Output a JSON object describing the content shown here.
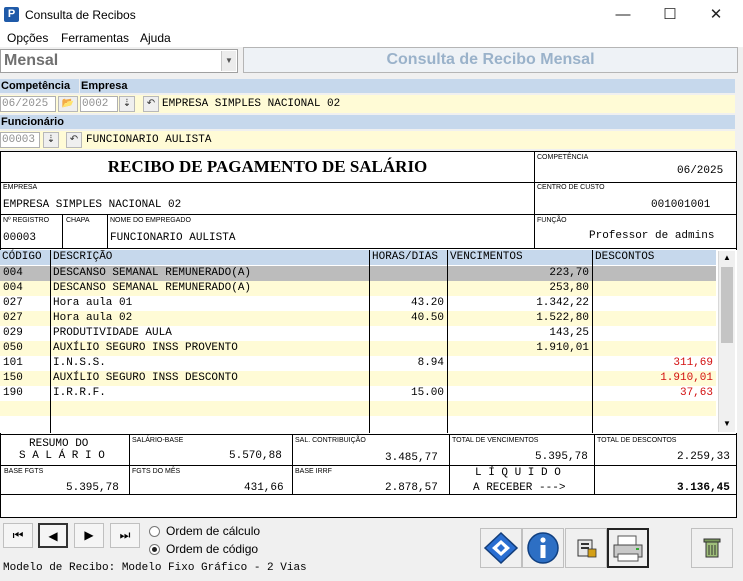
{
  "window": {
    "title": "Consulta de Recibos",
    "icon_letter": "P",
    "minimize": "—",
    "maximize": "☐",
    "close": "✕"
  },
  "menu": [
    "Opções",
    "Ferramentas",
    "Ajuda"
  ],
  "mode": {
    "value": "Mensal",
    "arrow": "▼"
  },
  "banner": "Consulta de Recibo Mensal",
  "filters": {
    "competencia_label": "Competência",
    "empresa_label": "Empresa",
    "competencia_value": "06/2025",
    "empresa_code": "0002",
    "empresa_name": "EMPRESA SIMPLES NACIONAL 02",
    "funcionario_label": "Funcionário",
    "funcionario_code": "00003",
    "funcionario_name": "FUNCIONARIO  AULISTA",
    "folder_icon": "📂",
    "spin_icon": "⇣",
    "undo_icon": "↶"
  },
  "receipt": {
    "title": "RECIBO DE PAGAMENTO DE SALÁRIO",
    "competencia_label": "COMPETÊNCIA",
    "competencia": "06/2025",
    "empresa_label": "EMPRESA",
    "empresa": "EMPRESA SIMPLES NACIONAL 02",
    "centro_label": "CENTRO DE CUSTO",
    "centro": "001001001",
    "registro_label": "Nº REGISTRO",
    "registro": "00003",
    "chapa_label": "CHAPA",
    "chapa": "",
    "nome_label": "NOME DO EMPREGADO",
    "nome": "FUNCIONARIO  AULISTA",
    "funcao_label": "FUNÇÃO",
    "funcao": "Professor de admins"
  },
  "grid": {
    "headers": [
      "CÓDIGO",
      "DESCRIÇÃO",
      "HORAS/DIAS",
      "VENCIMENTOS",
      "DESCONTOS"
    ],
    "rows": [
      {
        "codigo": "004",
        "descricao": "DESCANSO SEMANAL REMUNERADO(A)",
        "horas": "",
        "vencimentos": "223,70",
        "descontos": ""
      },
      {
        "codigo": "004",
        "descricao": "DESCANSO SEMANAL REMUNERADO(A)",
        "horas": "",
        "vencimentos": "253,80",
        "descontos": ""
      },
      {
        "codigo": "027",
        "descricao": "Hora aula 01",
        "horas": "43.20",
        "vencimentos": "1.342,22",
        "descontos": ""
      },
      {
        "codigo": "027",
        "descricao": "Hora aula 02",
        "horas": "40.50",
        "vencimentos": "1.522,80",
        "descontos": ""
      },
      {
        "codigo": "029",
        "descricao": "PRODUTIVIDADE AULA",
        "horas": "",
        "vencimentos": "143,25",
        "descontos": ""
      },
      {
        "codigo": "050",
        "descricao": "AUXÍLIO SEGURO  INSS PROVENTO",
        "horas": "",
        "vencimentos": "1.910,01",
        "descontos": ""
      },
      {
        "codigo": "101",
        "descricao": "I.N.S.S.",
        "horas": "8.94",
        "vencimentos": "",
        "descontos": "311,69"
      },
      {
        "codigo": "150",
        "descricao": "AUXÍLIO SEGURO  INSS DESCONTO",
        "horas": "",
        "vencimentos": "",
        "descontos": "1.910,01"
      },
      {
        "codigo": "190",
        "descricao": "I.R.R.F.",
        "horas": "15.00",
        "vencimentos": "",
        "descontos": "37,63"
      }
    ],
    "scroll_up": "▲",
    "scroll_down": "▼"
  },
  "summary": {
    "resumo_1": "RESUMO DO",
    "resumo_2": "S A L Á R I O",
    "salario_base_label": "SALÁRIO-BASE",
    "salario_base": "5.570,88",
    "sal_contrib_label": "SAL. CONTRIBUIÇÃO",
    "sal_contrib": "3.485,77",
    "total_venc_label": "TOTAL DE VENCIMENTOS",
    "total_venc": "5.395,78",
    "total_desc_label": "TOTAL DE DESCONTOS",
    "total_desc": "2.259,33",
    "base_fgts_label": "BASE FGTS",
    "base_fgts": "5.395,78",
    "fgts_mes_label": "FGTS DO MÊS",
    "fgts_mes": "431,66",
    "base_irrf_label": "BASE IRRF",
    "base_irrf": "2.878,57",
    "liquido_1": "L Í Q U I D O",
    "liquido_2": "A RECEBER --->",
    "liquido": "3.136,45"
  },
  "nav": {
    "first": "⏮",
    "prev": "◀",
    "next": "▶",
    "last": "⏭"
  },
  "order": {
    "calc": "Ordem de cálculo",
    "code": "Ordem de código"
  },
  "status": "Modelo de Recibo: Modelo Fixo Gráfico - 2 Vias"
}
